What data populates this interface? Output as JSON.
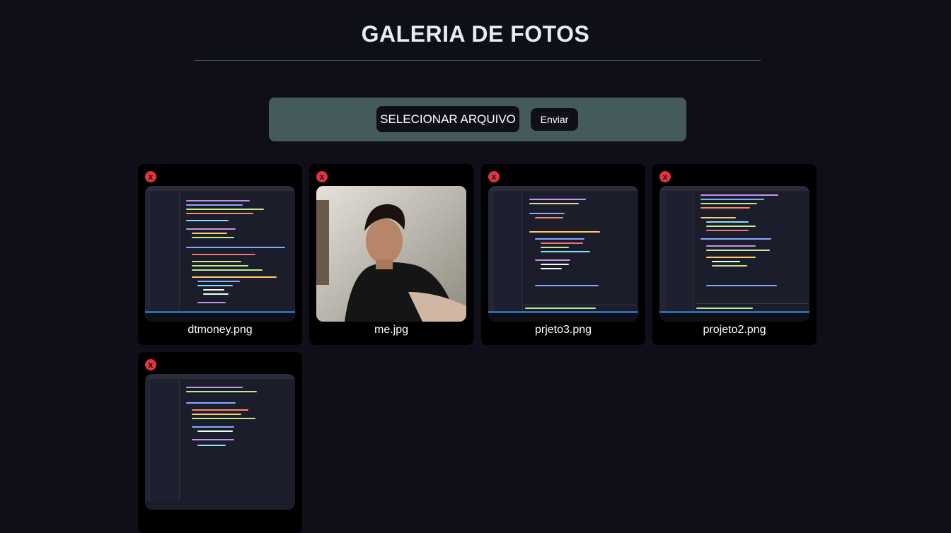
{
  "page": {
    "title": "GALERIA DE FOTOS"
  },
  "upload": {
    "select_label": "SELECIONAR ARQUIVO",
    "send_label": "Enviar"
  },
  "gallery": {
    "delete_glyph": "x",
    "items": [
      {
        "name": "dtmoney.png",
        "kind": "code-screenshot"
      },
      {
        "name": "me.jpg",
        "kind": "portrait-photo"
      },
      {
        "name": "prjeto3.png",
        "kind": "code-screenshot"
      },
      {
        "name": "projeto2.png",
        "kind": "code-screenshot"
      },
      {
        "name": "",
        "kind": "code-screenshot"
      }
    ]
  },
  "colors": {
    "background": "#0f0f1a",
    "upload_panel": "#455a5b",
    "delete_button": "#e23340",
    "card": "#000000"
  }
}
